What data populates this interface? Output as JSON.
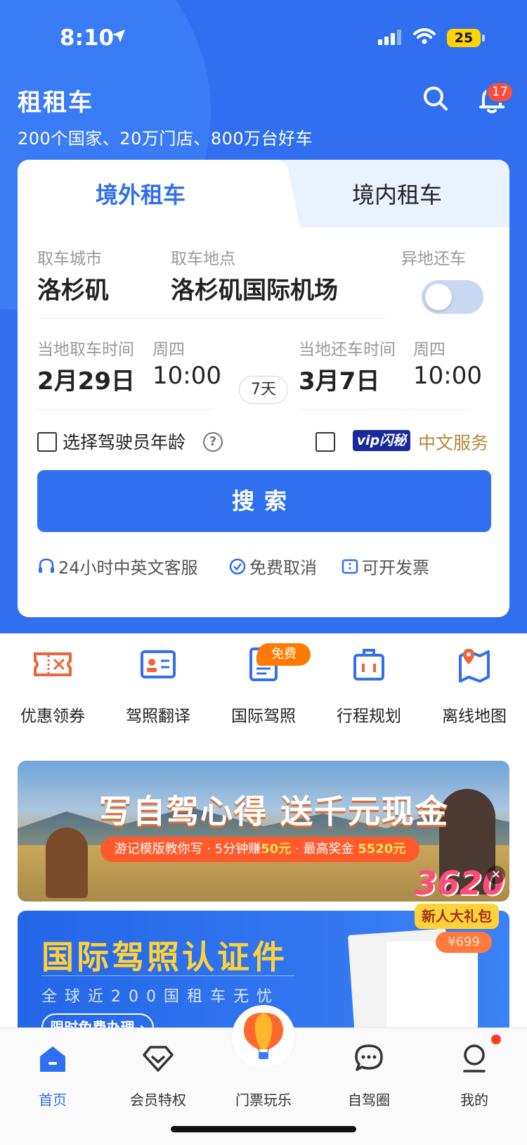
{
  "status_bar": {
    "time": "8:10",
    "battery": "25"
  },
  "header": {
    "app_title": "租租车",
    "subtitle": "200个国家、20万门店、800万台好车",
    "notification_count": "17"
  },
  "search_card": {
    "tabs": [
      {
        "label": "境外租车",
        "active": true
      },
      {
        "label": "境内租车",
        "active": false
      }
    ],
    "pickup_city_label": "取车城市",
    "pickup_city": "洛杉矶",
    "pickup_location_label": "取车地点",
    "pickup_location": "洛杉矶国际机场",
    "one_way_label": "异地还车",
    "one_way_enabled": false,
    "pickup_time_label": "当地取车时间",
    "pickup_weekday": "周四",
    "pickup_date": "2月29日",
    "pickup_time": "10:00",
    "duration": "7天",
    "return_time_label": "当地还车时间",
    "return_weekday": "周四",
    "return_date": "3月7日",
    "return_time": "10:00",
    "driver_age_label": "选择驾驶员年龄",
    "vip_badge": "vip闪秘",
    "chinese_service": "中文服务",
    "search_button": "搜索",
    "features": [
      "24小时中英文客服",
      "免费取消",
      "可开发票"
    ]
  },
  "quick_links": {
    "free_tag": "免费",
    "items": [
      {
        "label": "优惠领券",
        "icon": "coupon-icon"
      },
      {
        "label": "驾照翻译",
        "icon": "license-translate-icon"
      },
      {
        "label": "国际驾照",
        "icon": "intl-license-icon"
      },
      {
        "label": "行程规划",
        "icon": "itinerary-icon"
      },
      {
        "label": "离线地图",
        "icon": "offline-map-icon"
      }
    ]
  },
  "banner_travelogue": {
    "headline": "写自驾心得 送千元现金",
    "tagline_1": "游记模版教你写 · 5分钟赚",
    "amount_1": "50元",
    "tagline_2": " · 最高奖金",
    "amount_2": "5520元"
  },
  "banner_license": {
    "headline": "国际驾照认证件",
    "subline": "全球近200国租车无忧",
    "cta": "限时免费办理 ›"
  },
  "gift_popup": {
    "amount": "3620",
    "label": "新人大礼包",
    "price": "¥699"
  },
  "tab_bar": {
    "items": [
      {
        "label": "首页",
        "icon": "home-icon",
        "active": true
      },
      {
        "label": "会员特权",
        "icon": "diamond-icon",
        "active": false
      },
      {
        "label": "门票玩乐",
        "icon": "hot-air-balloon-icon",
        "active": false
      },
      {
        "label": "自驾圈",
        "icon": "chat-bubble-icon",
        "active": false
      },
      {
        "label": "我的",
        "icon": "profile-icon",
        "active": false
      }
    ]
  },
  "colors": {
    "primary": "#2f6ff0",
    "accent_gold": "#b28a3a",
    "badge_red": "#ff4d3d"
  }
}
